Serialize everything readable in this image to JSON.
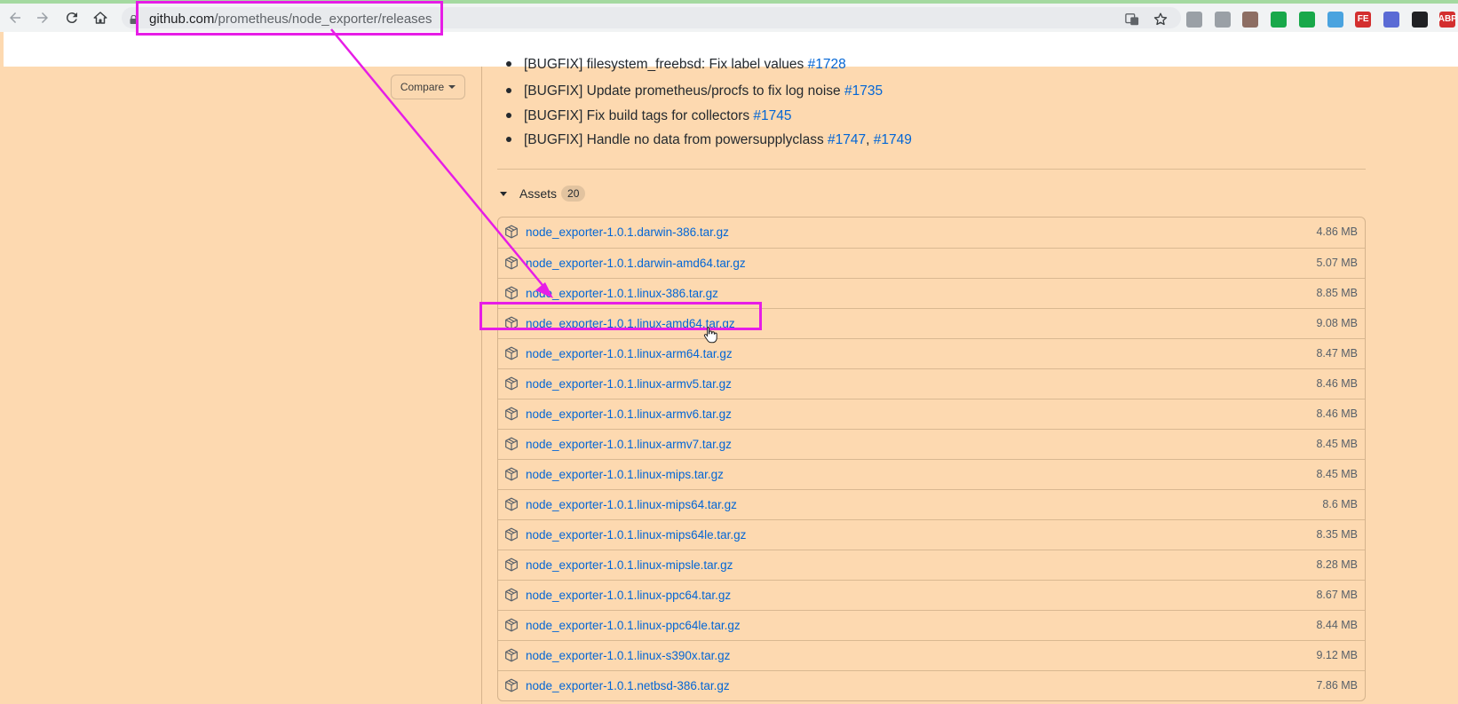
{
  "browser": {
    "url_host": "github.com",
    "url_path": "/prometheus/node_exporter/releases",
    "icons": [
      "back-arrow-icon",
      "forward-arrow-icon",
      "reload-icon",
      "home-icon",
      "lock-icon",
      "translate-icon",
      "bookmark-star-icon"
    ],
    "extensions": [
      {
        "name": "download-extension-icon",
        "label": "",
        "color": "#9aa0a6"
      },
      {
        "name": "generic-extension-icon",
        "label": "",
        "color": "#9aa0a6"
      },
      {
        "name": "pdf-extension-icon",
        "label": "",
        "color": "#8d6e63"
      },
      {
        "name": "shield-extension-icon",
        "label": "",
        "color": "#18a84a"
      },
      {
        "name": "privacy-extension-icon",
        "label": "",
        "color": "#18a84a"
      },
      {
        "name": "bird-extension-icon",
        "label": "",
        "color": "#4aa3df"
      },
      {
        "name": "fe-extension-icon",
        "label": "FE",
        "color": "#d32f2f"
      },
      {
        "name": "check-extension-icon",
        "label": "",
        "color": "#5b6bd5"
      },
      {
        "name": "mask-extension-icon",
        "label": "",
        "color": "#202124"
      },
      {
        "name": "adblock-extension-icon",
        "label": "ABP",
        "color": "#d32f2f"
      }
    ]
  },
  "sidebar": {
    "compare_label": "Compare"
  },
  "release_notes": [
    {
      "prefix": "[BUGFIX] filesystem_freebsd: Fix label values ",
      "links": [
        "#1728"
      ]
    },
    {
      "prefix": "[BUGFIX] Update prometheus/procfs to fix log noise ",
      "links": [
        "#1735"
      ]
    },
    {
      "prefix": "[BUGFIX] Fix build tags for collectors ",
      "links": [
        "#1745"
      ]
    },
    {
      "prefix": "[BUGFIX] Handle no data from powersupplyclass ",
      "links": [
        "#1747",
        "#1749"
      ]
    }
  ],
  "assets": {
    "title": "Assets",
    "count": "20",
    "files": [
      {
        "name": "node_exporter-1.0.1.darwin-386.tar.gz",
        "size": "4.86 MB"
      },
      {
        "name": "node_exporter-1.0.1.darwin-amd64.tar.gz",
        "size": "5.07 MB"
      },
      {
        "name": "node_exporter-1.0.1.linux-386.tar.gz",
        "size": "8.85 MB"
      },
      {
        "name": "node_exporter-1.0.1.linux-amd64.tar.gz",
        "size": "9.08 MB",
        "highlighted": true
      },
      {
        "name": "node_exporter-1.0.1.linux-arm64.tar.gz",
        "size": "8.47 MB"
      },
      {
        "name": "node_exporter-1.0.1.linux-armv5.tar.gz",
        "size": "8.46 MB"
      },
      {
        "name": "node_exporter-1.0.1.linux-armv6.tar.gz",
        "size": "8.46 MB"
      },
      {
        "name": "node_exporter-1.0.1.linux-armv7.tar.gz",
        "size": "8.45 MB"
      },
      {
        "name": "node_exporter-1.0.1.linux-mips.tar.gz",
        "size": "8.45 MB"
      },
      {
        "name": "node_exporter-1.0.1.linux-mips64.tar.gz",
        "size": "8.6 MB"
      },
      {
        "name": "node_exporter-1.0.1.linux-mips64le.tar.gz",
        "size": "8.35 MB"
      },
      {
        "name": "node_exporter-1.0.1.linux-mipsle.tar.gz",
        "size": "8.28 MB"
      },
      {
        "name": "node_exporter-1.0.1.linux-ppc64.tar.gz",
        "size": "8.67 MB"
      },
      {
        "name": "node_exporter-1.0.1.linux-ppc64le.tar.gz",
        "size": "8.44 MB"
      },
      {
        "name": "node_exporter-1.0.1.linux-s390x.tar.gz",
        "size": "9.12 MB"
      },
      {
        "name": "node_exporter-1.0.1.netbsd-386.tar.gz",
        "size": "7.86 MB"
      }
    ]
  },
  "annotation": {
    "color": "#e61de6"
  }
}
